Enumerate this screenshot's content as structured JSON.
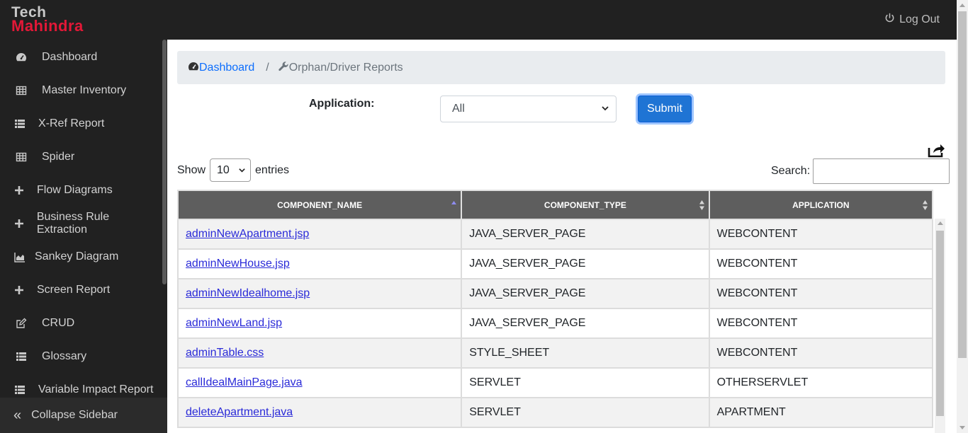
{
  "brand": {
    "line1": "Tech",
    "line2": "Mahindra"
  },
  "header": {
    "logout_label": "Log Out"
  },
  "sidebar": {
    "items": [
      {
        "label": "Dashboard",
        "icon": "dashboard-gauge-icon"
      },
      {
        "label": "Master Inventory",
        "icon": "table-icon"
      },
      {
        "label": "X-Ref Report",
        "icon": "list-icon"
      },
      {
        "label": "Spider",
        "icon": "table-icon"
      },
      {
        "label": "Flow Diagrams",
        "icon": "plus-icon"
      },
      {
        "label": "Business Rule Extraction",
        "icon": "plus-icon"
      },
      {
        "label": "Sankey Diagram",
        "icon": "area-chart-icon"
      },
      {
        "label": "Screen Report",
        "icon": "plus-icon"
      },
      {
        "label": "CRUD",
        "icon": "edit-icon"
      },
      {
        "label": "Glossary",
        "icon": "list-icon"
      },
      {
        "label": "Variable Impact Report",
        "icon": "list-icon"
      }
    ],
    "collapse_label": "Collapse Sidebar"
  },
  "breadcrumb": {
    "home": "Dashboard",
    "separator": "/",
    "current": "Orphan/Driver Reports"
  },
  "filter": {
    "application_label": "Application:",
    "application_value": "All",
    "submit_label": "Submit"
  },
  "table_controls": {
    "show_label": "Show",
    "entries_value": "10",
    "entries_label": "entries",
    "search_label": "Search:",
    "search_value": ""
  },
  "table": {
    "columns": [
      "COMPONENT_NAME",
      "COMPONENT_TYPE",
      "APPLICATION"
    ],
    "rows": [
      [
        "adminNewApartment.jsp",
        "JAVA_SERVER_PAGE",
        "WEBCONTENT"
      ],
      [
        "adminNewHouse.jsp",
        "JAVA_SERVER_PAGE",
        "WEBCONTENT"
      ],
      [
        "adminNewIdealhome.jsp",
        "JAVA_SERVER_PAGE",
        "WEBCONTENT"
      ],
      [
        "adminNewLand.jsp",
        "JAVA_SERVER_PAGE",
        "WEBCONTENT"
      ],
      [
        "adminTable.css",
        "STYLE_SHEET",
        "WEBCONTENT"
      ],
      [
        "callIdealMainPage.java",
        "SERVLET",
        "OTHERSERVLET"
      ],
      [
        "deleteApartment.java",
        "SERVLET",
        "APARTMENT"
      ]
    ]
  },
  "colors": {
    "topbar": "#212121",
    "brand_red": "#e31837",
    "accent": "#1f74d4",
    "header_bg": "#5e5e5e"
  }
}
